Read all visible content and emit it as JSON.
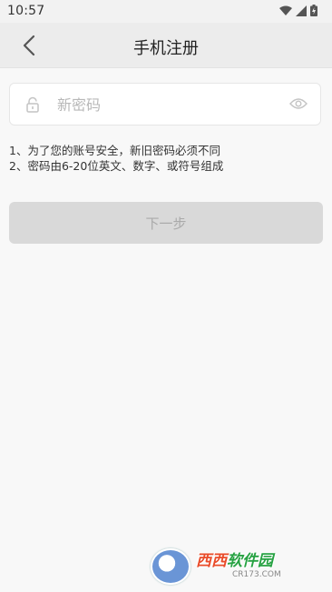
{
  "status_bar": {
    "time": "10:57"
  },
  "header": {
    "title": "手机注册"
  },
  "password_field": {
    "placeholder": "新密码",
    "value": ""
  },
  "rules": {
    "line1": "1、为了您的账号安全，新旧密码必须不同",
    "line2": "2、密码由6-20位英文、数字、或符号组成"
  },
  "next_button": {
    "label": "下一步"
  },
  "watermark": {
    "brand_red": "西西",
    "brand_green": "软件园",
    "site": "CR173.COM"
  },
  "icons": {
    "back": "chevron-left-icon",
    "lock": "lock-icon",
    "visibility": "eye-icon"
  },
  "colors": {
    "button_disabled_bg": "#d9d9d9",
    "button_disabled_text": "#aaaaaa",
    "placeholder": "#b8b8b8"
  }
}
